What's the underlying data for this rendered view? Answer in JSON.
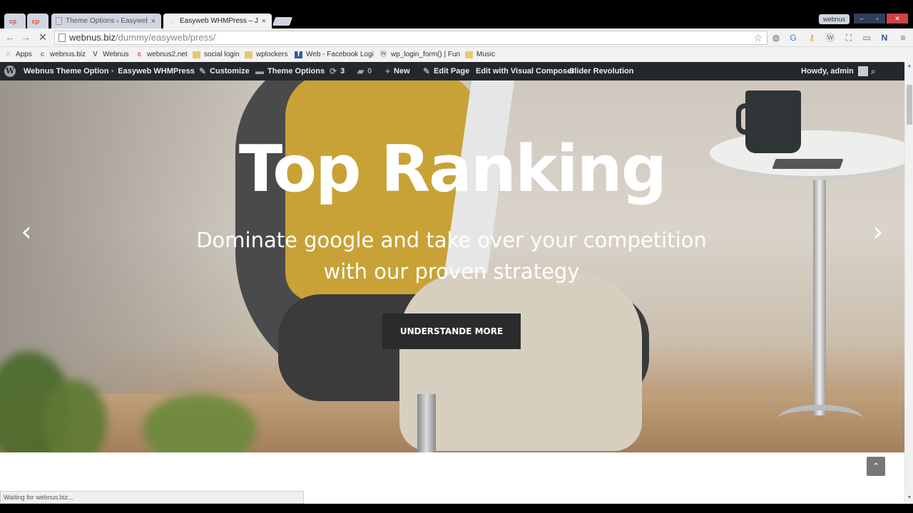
{
  "browser": {
    "tabs": [
      {
        "title": "Theme Options ‹ Easyweb",
        "favicon": "wp-favicon",
        "active": false
      },
      {
        "title": "Easyweb WHMPress – Just",
        "favicon": "loading-favicon",
        "active": true
      }
    ],
    "pinned_tab_icon": "cp",
    "close_glyph": "×",
    "profile_name": "webnus",
    "window_controls": {
      "minimize": "–",
      "maximize": "▫",
      "close": "✕"
    },
    "url_host": "webnus.biz",
    "url_path": "/dummy/easyweb/press/",
    "status_text": "Waiting for webnus.biz..."
  },
  "bookmarks": [
    {
      "label": "Apps",
      "icon": "apps-grid-icon"
    },
    {
      "label": "webnus.biz",
      "icon": "cp-icon"
    },
    {
      "label": "Webnus",
      "icon": "webnus-icon"
    },
    {
      "label": "webnus2.net",
      "icon": "cp-icon"
    },
    {
      "label": "social login",
      "icon": "folder-icon"
    },
    {
      "label": "wplockers",
      "icon": "folder-icon"
    },
    {
      "label": "Web - Facebook Logi",
      "icon": "facebook-icon"
    },
    {
      "label": "wp_login_form() | Fun",
      "icon": "wordpress-icon"
    },
    {
      "label": "Music",
      "icon": "folder-icon"
    }
  ],
  "adminbar": {
    "site_name": "Webnus Theme Option",
    "theme_name": "Easyweb WHMPress",
    "customize": "Customize",
    "theme_options": "Theme Options",
    "updates_count": "3",
    "comments_count": "0",
    "new": "New",
    "edit_page": "Edit Page",
    "visual_composer": "Edit with Visual Composer",
    "slider_revolution": "Slider Revolution",
    "greeting": "Howdy, admin"
  },
  "hero": {
    "title": "Top Ranking",
    "subtitle_line1": "Dominate google and take over your competition",
    "subtitle_line2": "with our proven strategy",
    "button_label": "UNDERSTANDE MORE",
    "prev_arrow": "‹",
    "next_arrow": "›"
  },
  "colors": {
    "admin_bar_bg": "#23282d",
    "button_bg": "#2a2b2d",
    "hero_text": "#ffffff"
  }
}
